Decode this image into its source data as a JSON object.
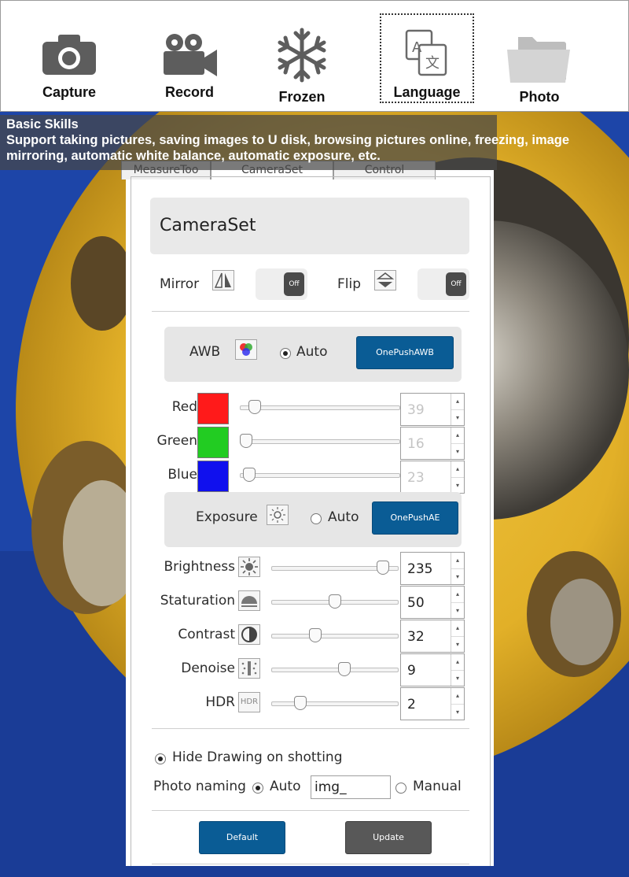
{
  "toolbar": {
    "items": [
      {
        "label": "Capture",
        "icon": "camera-icon"
      },
      {
        "label": "Record",
        "icon": "video-camera-icon"
      },
      {
        "label": "Frozen",
        "icon": "snowflake-icon"
      },
      {
        "label": "Language",
        "icon": "translate-icon",
        "selected": true
      },
      {
        "label": "Photo",
        "icon": "folder-icon"
      }
    ]
  },
  "banner": {
    "title": "Basic Skills",
    "description": "Support taking pictures, saving images to U disk, browsing pictures online, freezing, image mirroring, automatic white balance, automatic exposure, etc."
  },
  "panel": {
    "tabs": [
      {
        "label": "MeasureToo"
      },
      {
        "label": "CameraSet",
        "active": true
      },
      {
        "label": "Control"
      }
    ],
    "header": "CameraSet",
    "mirror": {
      "label": "Mirror",
      "state": "Off"
    },
    "flip": {
      "label": "Flip",
      "state": "Off"
    },
    "awb": {
      "label": "AWB",
      "auto_label": "Auto",
      "auto_checked": true,
      "button": "OnePushAWB",
      "channels": [
        {
          "label": "Red",
          "color": "#ff1a1a",
          "value": "39",
          "fraction": 0.06
        },
        {
          "label": "Green",
          "color": "#22cc22",
          "value": "16",
          "fraction": 0.0
        },
        {
          "label": "Blue",
          "color": "#1010ee",
          "value": "23",
          "fraction": 0.02
        }
      ]
    },
    "exposure": {
      "label": "Exposure",
      "auto_label": "Auto",
      "auto_checked": false,
      "button": "OnePushAE"
    },
    "adjustments": [
      {
        "label": "Brightness",
        "icon": "brightness-icon",
        "value": "235",
        "fraction": 0.92
      },
      {
        "label": "Staturation",
        "icon": "saturation-icon",
        "value": "50",
        "fraction": 0.5
      },
      {
        "label": "Contrast",
        "icon": "contrast-icon",
        "value": "32",
        "fraction": 0.33
      },
      {
        "label": "Denoise",
        "icon": "denoise-icon",
        "value": "9",
        "fraction": 0.58
      },
      {
        "label": "HDR",
        "icon": "hdr-icon",
        "value": "2",
        "fraction": 0.2
      }
    ],
    "hdr_icon_text": "HDR",
    "hide_drawing": {
      "label": "Hide Drawing on shotting",
      "checked": true
    },
    "photo_naming": {
      "label": "Photo naming",
      "auto_label": "Auto",
      "auto_checked": true,
      "input_value": "img_",
      "manual_label": "Manual"
    },
    "buttons": {
      "default": "Default",
      "update": "Update"
    }
  }
}
